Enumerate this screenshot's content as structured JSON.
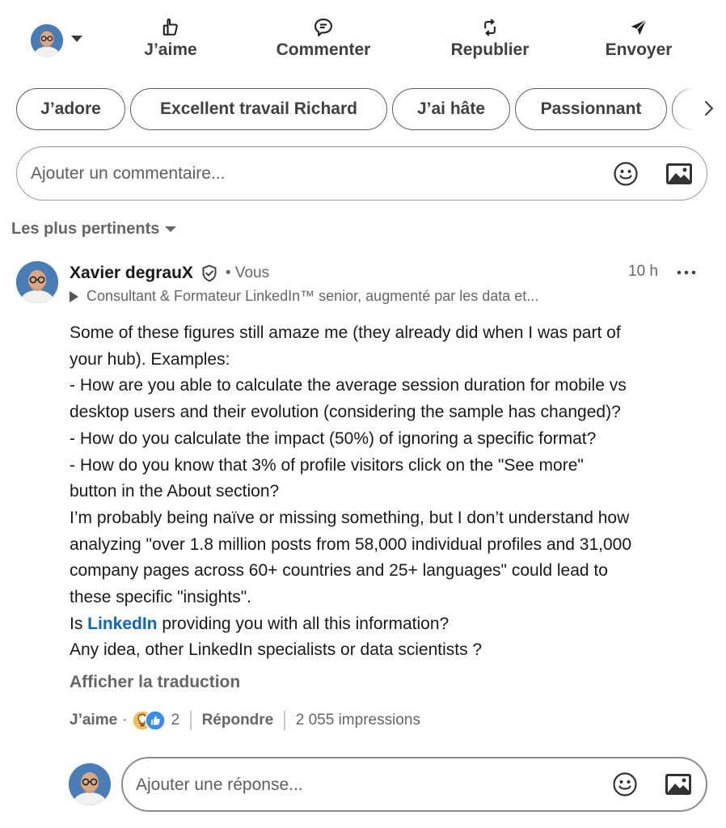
{
  "action_bar": {
    "avatar": "user-avatar",
    "actions": [
      {
        "label": "J’aime",
        "icon": "like-icon"
      },
      {
        "label": "Commenter",
        "icon": "comment-icon"
      },
      {
        "label": "Republier",
        "icon": "repost-icon"
      },
      {
        "label": "Envoyer",
        "icon": "send-icon"
      }
    ]
  },
  "suggestions": [
    "J’adore",
    "Excellent travail Richard",
    "J’ai hâte",
    "Passionnant"
  ],
  "comment_box": {
    "placeholder": "Ajouter un commentaire..."
  },
  "sort": {
    "label": "Les plus pertinents"
  },
  "comment": {
    "author": "Xavier degrauX",
    "you": "• Vous",
    "time": "10 h",
    "headline": "Consultant & Formateur LinkedIn™ senior, augmenté par les data et...",
    "body": {
      "lines": [
        "Some of these figures still amaze me (they already did when I was part of",
        "your hub). Examples:",
        "- How are you able to calculate the average session duration for mobile vs",
        "desktop users and their evolution (considering the sample has changed)?",
        "- How do you calculate the impact (50%) of ignoring a specific format?",
        "- How do you know that 3% of profile visitors click on the \"See more\"",
        "button in the About section?",
        "I’m probably being naïve or missing something, but I don’t understand how",
        "analyzing \"over 1.8 million posts from 58,000 individual profiles and 31,000",
        "company pages across 60+ countries and 25+ languages\" could lead to",
        "these specific \"insights\"."
      ],
      "line12_prefix": "Is ",
      "mention": "LinkedIn",
      "line12_suffix": " providing you with all this information?",
      "last_line": "Any idea, other LinkedIn specialists or data scientists ?"
    },
    "translate": "Afficher la traduction",
    "actions": {
      "like": "J’aime",
      "dot": "·",
      "reaction_count": "2",
      "reply": "Répondre",
      "impressions": "2 055 impressions"
    }
  },
  "reply_box": {
    "placeholder": "Ajouter une réponse..."
  },
  "colors": {
    "link": "#0a66c2",
    "secondary_text": "#666666",
    "primary_text": "#191919",
    "border": "#9c9c9c"
  }
}
